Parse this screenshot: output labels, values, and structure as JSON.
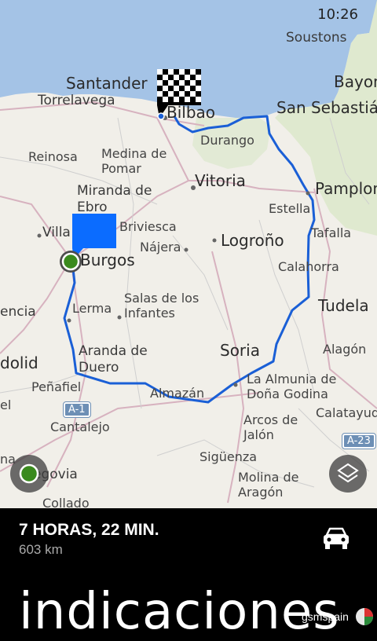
{
  "status_bar": {
    "time": "10:26"
  },
  "map": {
    "labels": {
      "soustons": "Soustons",
      "bayonne": "Bayon",
      "santander": "Santander",
      "torrelavega": "Torrelavega",
      "bilbao": "Bilbao",
      "san_sebastian": "San Sebastián",
      "durango": "Durango",
      "reinosa": "Reinosa",
      "medina_de_pomar": "Medina de\nPomar",
      "vitoria": "Vitoria",
      "pamplona": "Pamplon",
      "miranda_de_ebro": "Miranda de\nEbro",
      "estella": "Estella",
      "briviesca": "Briviesca",
      "villa": "Villa",
      "logrono": "Logroño",
      "tafalla": "Tafalla",
      "najera": "Nájera",
      "burgos": "Burgos",
      "calahorra": "Calahorra",
      "palencia": "encia",
      "lerma": "Lerma",
      "salas_de_los_infantes": "Salas de los\nInfantes",
      "tudela": "Tudela",
      "aranda_de_duero": "Aranda de\nDuero",
      "soria": "Soria",
      "alagon": "Alagón",
      "valladolid": "dolid",
      "penafiel": "Peñafiel",
      "almazan": "Almazán",
      "la_almunia": "La Almunia de\nDoña Godina",
      "arcos_de_jalon": "Arcos de\nJalón",
      "calatayud": "Calatayud",
      "cantalejo": "Cantalejo",
      "el": "el",
      "na": "na",
      "siguenza": "Sigüenza",
      "segovia": "egovia",
      "molina_de_aragon": "Molina de\nAragón",
      "collado": "Collado",
      "a23": "A-23",
      "a1": "A-1"
    },
    "colors": {
      "route": "#1a5fd6",
      "water": "#a4c3e6",
      "france": "#dfe9cf",
      "pin": "#0b6cff",
      "start": "#3a8a1e"
    }
  },
  "summary": {
    "duration": "7 HORAS, 22 MIN.",
    "distance": "603 km",
    "title": "indicaciones",
    "watermark": "gsmspain"
  },
  "icons": {
    "start_location": "location-dot-icon",
    "layers": "layers-icon",
    "car": "car-icon",
    "destination": "checkered-flag-icon"
  }
}
